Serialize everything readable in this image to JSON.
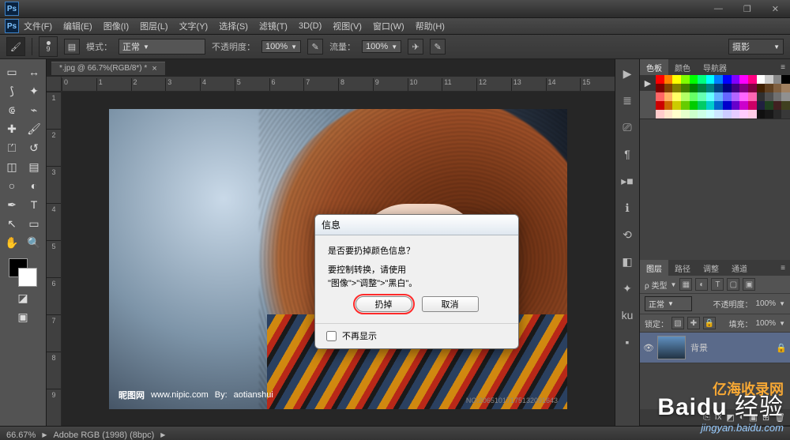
{
  "app": {
    "logo_text": "Ps",
    "title_placeholder": ""
  },
  "win": {
    "minimize": "—",
    "restore": "❐",
    "close": "✕"
  },
  "menu": {
    "file": "文件(F)",
    "edit": "编辑(E)",
    "image": "图像(I)",
    "layer": "图层(L)",
    "type": "文字(Y)",
    "select": "选择(S)",
    "filter": "滤镜(T)",
    "threeD": "3D(D)",
    "view": "视图(V)",
    "window": "窗口(W)",
    "help": "帮助(H)"
  },
  "options": {
    "brush_size": "9",
    "mode_label": "模式：",
    "mode_value": "正常",
    "opacity_label": "不透明度：",
    "opacity_value": "100%",
    "flow_label": "流量：",
    "flow_value": "100%",
    "workspace_drop": "摄影"
  },
  "tools": {
    "move": "↔",
    "marquee": "▭",
    "lasso": "⟆",
    "wand": "✦",
    "crop": "⟃",
    "eyedrop": "⌁",
    "heal": "✚",
    "brush": "🖌",
    "stamp": "⏍",
    "history": "↺",
    "eraser": "◫",
    "gradient": "▤",
    "blur": "○",
    "dodge": "◐",
    "pen": "✒",
    "type": "T",
    "path": "↖",
    "shape": "▭",
    "hand": "✋",
    "zoom": "🔍",
    "switch": "⤡",
    "default": "◱",
    "quickmask": "◪",
    "screen": "▣"
  },
  "doc": {
    "tab": "*.jpg @ 66.7%(RGB/8*) *",
    "ruler_top": [
      "0",
      "1",
      "2",
      "3",
      "4",
      "5",
      "6",
      "7",
      "8",
      "9",
      "10",
      "11",
      "12",
      "13",
      "14",
      "15"
    ],
    "ruler_left": [
      "1",
      "2",
      "3",
      "4",
      "5",
      "6",
      "7",
      "8",
      "9"
    ]
  },
  "photo": {
    "wm_site": "昵图网",
    "wm_url": "www.nipic.com",
    "wm_by_label": "By:",
    "wm_by": "aotianshui",
    "wm_id": "NO:20651017175132091643"
  },
  "dialog": {
    "title": "信息",
    "question": "是否要扔掉颜色信息？",
    "hint_line1": "要控制转换，请使用",
    "hint_line2": "\"图像\">\"调整\">\"黑白\"。",
    "ok": "扔掉",
    "cancel": "取消",
    "dont_show": "不再显示"
  },
  "rail": {
    "play": "▶",
    "timeline": "≣",
    "option": "⎚",
    "paragraph": "¶",
    "actions": "▸■",
    "info": "ℹ",
    "history": "⟲",
    "prop": "◧",
    "brush": "✦",
    "krn": "ku",
    "mask": "▪"
  },
  "panel_swatch": {
    "tab_swatches": "色板",
    "tab_color": "颜色",
    "tab_nav": "导航器",
    "colors": [
      "#ff0000",
      "#ff8000",
      "#ffff00",
      "#80ff00",
      "#00ff00",
      "#00ff80",
      "#00ffff",
      "#0080ff",
      "#0000ff",
      "#8000ff",
      "#ff00ff",
      "#ff0080",
      "#ffffff",
      "#cccccc",
      "#888888",
      "#000000",
      "#800000",
      "#804000",
      "#808000",
      "#408000",
      "#008000",
      "#008040",
      "#008080",
      "#004080",
      "#000080",
      "#400080",
      "#800080",
      "#800040",
      "#402000",
      "#604020",
      "#806040",
      "#a08060",
      "#ff6666",
      "#ffb366",
      "#ffff66",
      "#b3ff66",
      "#66ff66",
      "#66ffb3",
      "#66ffff",
      "#66b3ff",
      "#6666ff",
      "#b366ff",
      "#ff66ff",
      "#ff66b3",
      "#303030",
      "#505050",
      "#707070",
      "#909090",
      "#cc0000",
      "#cc6600",
      "#cccc00",
      "#66cc00",
      "#00cc00",
      "#00cc66",
      "#00cccc",
      "#0066cc",
      "#0000cc",
      "#6600cc",
      "#cc00cc",
      "#cc0066",
      "#202040",
      "#204020",
      "#402020",
      "#404020",
      "#ffcccc",
      "#ffe6cc",
      "#ffffcc",
      "#e6ffcc",
      "#ccffcc",
      "#ccffe6",
      "#ccffff",
      "#cce6ff",
      "#ccccff",
      "#e6ccff",
      "#ffccff",
      "#ffcce6",
      "#101010",
      "#181818",
      "#282828",
      "#383838"
    ]
  },
  "panel_layers": {
    "tab_layers": "图层",
    "tab_paths": "路径",
    "tab_adjust": "调整",
    "tab_channels": "通道",
    "filter_label": "ρ 类型",
    "blend": "正常",
    "opacity_label": "不透明度：",
    "opacity": "100%",
    "lock_label": "锁定：",
    "fill_label": "填充：",
    "fill": "100%",
    "layer0": "背景",
    "lock_icon": "🔒",
    "icons": {
      "img": "▦",
      "adj": "◐",
      "txt": "T",
      "shp": "▢",
      "smart": "▣"
    },
    "footer": {
      "link": "⎘",
      "fx": "fx",
      "mask": "◩",
      "adj": "◐",
      "group": "▣",
      "new": "⊞",
      "trash": "🗑"
    }
  },
  "status": {
    "zoom": "66.67%",
    "profile": "Adobe RGB (1998) (8bpc)"
  },
  "wm": {
    "baidu": "Baidu 经验",
    "url": "jingyan.baidu.com",
    "site": "亿海收录网"
  }
}
